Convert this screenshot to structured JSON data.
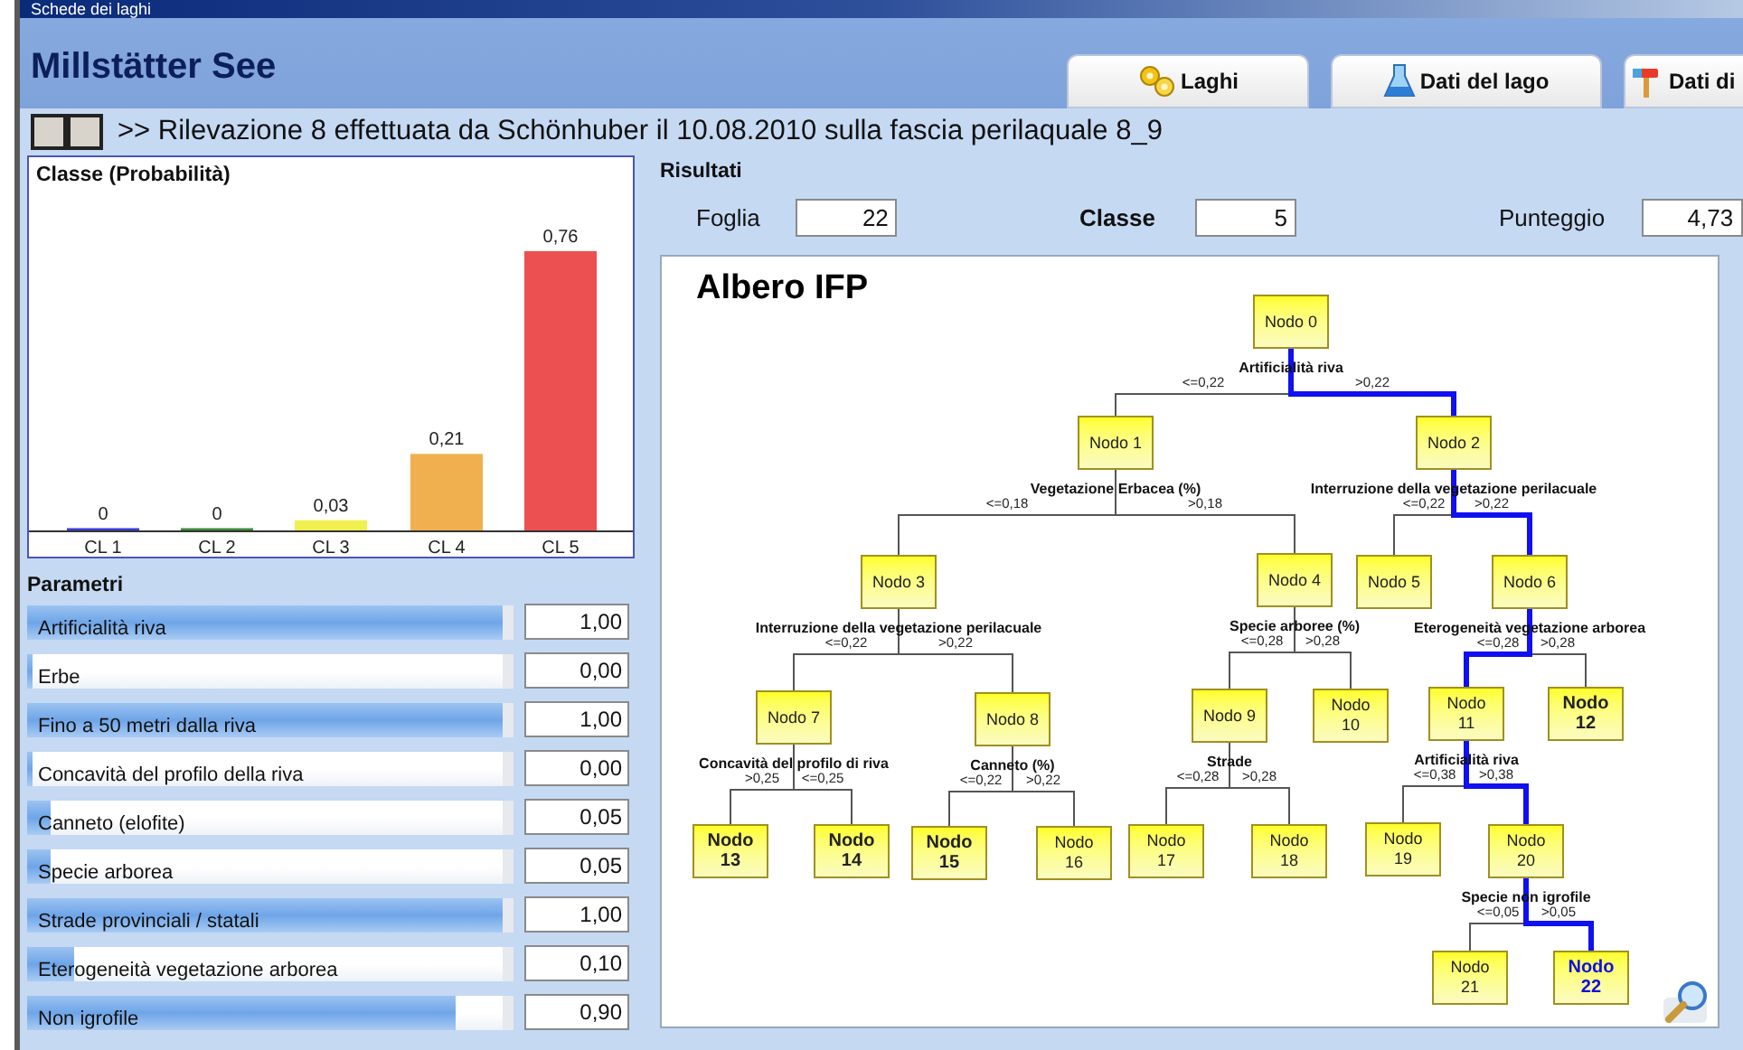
{
  "window": {
    "title": "Schede dei laghi"
  },
  "header": {
    "title": "Millstätter See"
  },
  "tabs": [
    {
      "label": "Laghi",
      "kind": "gears"
    },
    {
      "label": "Dati del lago",
      "kind": "flask"
    },
    {
      "label": "Dati di",
      "kind": "hammer"
    }
  ],
  "survey": {
    "text": ">> Rilevazione 8 effettuata da Schönhuber il 10.08.2010 sulla fascia perilaquale 8_9"
  },
  "class_panel": {
    "chart_data": {
      "type": "bar",
      "title": "Classe (Probabilità)",
      "categories": [
        "CL 1",
        "CL 2",
        "CL 3",
        "CL 4",
        "CL 5"
      ],
      "stacked": true,
      "series": [
        {
          "color": "#3c3cd8",
          "values": [
            0,
            null,
            null,
            null,
            null
          ],
          "value_labels": [
            "0",
            null,
            null,
            null,
            null
          ]
        },
        {
          "color": "#3c8c3c",
          "values": [
            null,
            0,
            null,
            null,
            null
          ],
          "value_labels": [
            null,
            "0",
            null,
            null,
            null
          ]
        },
        {
          "color": "#f0f050",
          "values": [
            null,
            null,
            0.03,
            null,
            null
          ],
          "value_labels": [
            null,
            null,
            "0,03",
            null,
            null
          ]
        },
        {
          "color": "#f0b050",
          "values": [
            null,
            null,
            null,
            0.21,
            null
          ],
          "value_labels": [
            null,
            null,
            null,
            "0,21",
            null
          ]
        },
        {
          "color": "#ec5050",
          "values": [
            null,
            null,
            null,
            null,
            0.76
          ],
          "value_labels": [
            null,
            null,
            null,
            null,
            "0,76"
          ]
        }
      ]
    }
  },
  "parameters": {
    "title": "Parametri",
    "items": [
      {
        "name": "Artificialità riva",
        "level": 1.0,
        "value": "1,00"
      },
      {
        "name": "Erbe",
        "level": 0.0,
        "value": "0,00"
      },
      {
        "name": "Fino a 50 metri dalla riva",
        "level": 1.0,
        "value": "1,00"
      },
      {
        "name": "Concavità del profilo della riva",
        "level": 0.0,
        "value": "0,00"
      },
      {
        "name": "Canneto (elofite)",
        "level": 0.05,
        "value": "0,05"
      },
      {
        "name": "Specie arborea",
        "level": 0.05,
        "value": "0,05"
      },
      {
        "name": "Strade provinciali / statali",
        "level": 1.0,
        "value": "1,00"
      },
      {
        "name": "Eterogeneità vegetazione arborea",
        "level": 0.1,
        "value": "0,10"
      },
      {
        "name": "Non igrofile",
        "level": 0.9,
        "value": "0,90"
      }
    ]
  },
  "results": {
    "title": "Risultati",
    "fields": [
      {
        "label": "Foglia",
        "value": "22",
        "bold": false
      },
      {
        "label": "Classe",
        "value": "5",
        "bold": true
      },
      {
        "label": "Punteggio",
        "value": "4,73",
        "bold": false
      }
    ]
  },
  "tree": {
    "title": "Albero IFP",
    "root": {
      "label": "Nodo 0",
      "split": "Artificialità riva",
      "bold": false,
      "selected": false,
      "children": [
        {
          "branch": "<=0,22",
          "label": "Nodo 1",
          "split": "Vegetazione Erbacea (%)",
          "bold": false,
          "selected": false,
          "on_path": false,
          "children": [
            {
              "branch": "<=0,18",
              "label": "Nodo 3",
              "split": "Interruzione della vegetazione perilacuale",
              "bold": false,
              "selected": false,
              "on_path": false,
              "children": [
                {
                  "branch": "<=0,22",
                  "label": "Nodo 7",
                  "split": "Concavità del profilo di riva",
                  "bold": false,
                  "selected": false,
                  "on_path": false,
                  "children": [
                    {
                      "branch": ">0,25",
                      "label": "Nodo\n13",
                      "bold": true,
                      "selected": false,
                      "on_path": false
                    },
                    {
                      "branch": "<=0,25",
                      "label": "Nodo\n14",
                      "bold": true,
                      "selected": false,
                      "on_path": false
                    }
                  ]
                },
                {
                  "branch": ">0,22",
                  "label": "Nodo 8",
                  "split": "Canneto (%)",
                  "bold": false,
                  "selected": false,
                  "on_path": false,
                  "children": [
                    {
                      "branch": "<=0,22",
                      "label": "Nodo\n15",
                      "bold": true,
                      "selected": false,
                      "on_path": false
                    },
                    {
                      "branch": ">0,22",
                      "label": "Nodo\n16",
                      "bold": false,
                      "selected": false,
                      "on_path": false
                    }
                  ]
                }
              ]
            },
            {
              "branch": ">0,18",
              "label": "Nodo 4",
              "split": "Specie arboree (%)",
              "bold": false,
              "selected": false,
              "on_path": false,
              "children": [
                {
                  "branch": "<=0,28",
                  "label": "Nodo 9",
                  "split": "Strade",
                  "bold": false,
                  "selected": false,
                  "on_path": false,
                  "children": [
                    {
                      "branch": "<=0,28",
                      "label": "Nodo\n17",
                      "bold": false,
                      "selected": false,
                      "on_path": false
                    },
                    {
                      "branch": ">0,28",
                      "label": "Nodo\n18",
                      "bold": false,
                      "selected": false,
                      "on_path": false
                    }
                  ]
                },
                {
                  "branch": ">0,28",
                  "label": "Nodo\n10",
                  "bold": false,
                  "selected": false,
                  "on_path": false
                }
              ]
            }
          ]
        },
        {
          "branch": ">0,22",
          "label": "Nodo 2",
          "split": "Interruzione della vegetazione perilacuale",
          "bold": false,
          "selected": false,
          "on_path": true,
          "children": [
            {
              "branch": "<=0,22",
              "label": "Nodo 5",
              "bold": false,
              "selected": false,
              "on_path": false
            },
            {
              "branch": ">0,22",
              "label": "Nodo 6",
              "split": "Eterogeneità vegetazione arborea",
              "bold": false,
              "selected": false,
              "on_path": true,
              "children": [
                {
                  "branch": "<=0,28",
                  "label": "Nodo\n11",
                  "split": "Artificialità riva",
                  "bold": false,
                  "selected": false,
                  "on_path": true,
                  "children": [
                    {
                      "branch": "<=0,38",
                      "label": "Nodo\n19",
                      "bold": false,
                      "selected": false,
                      "on_path": false
                    },
                    {
                      "branch": ">0,38",
                      "label": "Nodo\n20",
                      "split": "Specie non igrofile",
                      "bold": false,
                      "selected": false,
                      "on_path": true,
                      "children": [
                        {
                          "branch": "<=0,05",
                          "label": "Nodo\n21",
                          "bold": false,
                          "selected": false,
                          "on_path": false
                        },
                        {
                          "branch": ">0,05",
                          "label": "Nodo\n22",
                          "bold": true,
                          "selected": true,
                          "on_path": true
                        }
                      ]
                    }
                  ]
                },
                {
                  "branch": ">0,28",
                  "label": "Nodo\n12",
                  "bold": true,
                  "selected": false,
                  "on_path": false
                }
              ]
            }
          ]
        }
      ]
    }
  }
}
